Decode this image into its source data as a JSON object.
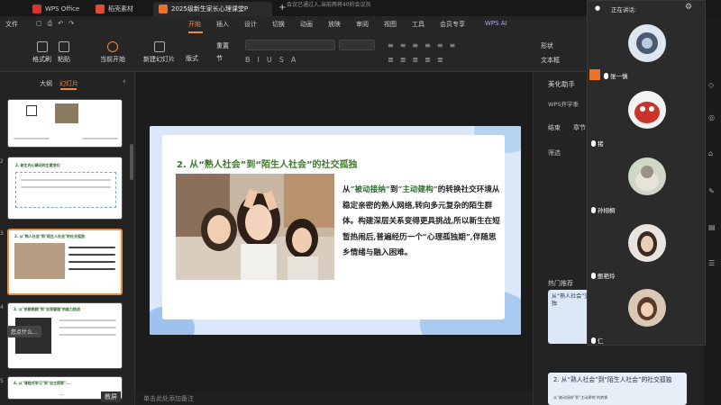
{
  "tabs": {
    "app": "WPS Office",
    "tab2": "稻壳素材",
    "tab3": "2025级新生家长心理课堂P",
    "notice": "会议已通过入,当前两将40的会议员"
  },
  "menu": {
    "file": "文件",
    "items": [
      "开始",
      "插入",
      "设计",
      "切换",
      "动画",
      "放映",
      "审阅",
      "视图",
      "工具",
      "会员专享"
    ],
    "ai": "WPS AI"
  },
  "ribbon": {
    "format_painter": "格式刷",
    "paste": "粘贴",
    "from_start": "当前开始",
    "new_slide": "新建幻灯片",
    "layout": "版式",
    "section": "节",
    "reset": "重置",
    "shape": "形状",
    "textbox": "文本框"
  },
  "left_panel": {
    "outline": "大纲",
    "slides": "幻灯片",
    "thumb2_title": "2. 新生内心躁动的主要变化",
    "thumb3_title": "2. 从\"熟人社会\"到\"陌生人社会\"的社交孤独",
    "thumb4_title": "3. 从\"依赖照顾\"到\"自我管理\"的能力挑战",
    "thumb5_title": "4. 从\"课程式学习\"到\"自主探索\"...",
    "search_overlay": "您点什么...",
    "add_icon": "+",
    "template_button": "教屏",
    "slide_numbers": [
      "1",
      "2",
      "3",
      "4",
      "5"
    ]
  },
  "slide": {
    "title": "2. 从“熟人社会”到“陌生人社会”的社交孤独",
    "body_prefix": "从",
    "body_hl1": "“被动接纳”",
    "body_mid": "到",
    "body_hl2": "“主动建构”",
    "body_rest": "的转换社交环境从稳定亲密的熟人网络,转向多元复杂的陌生群体。构建深层关系变得更具挑战,所以新生在短暂热闹后,普遍经历一个“心理孤独期”,伴随思乡情绪与融入困难。"
  },
  "notes_placeholder": "单击此处添加备注",
  "right_panel": {
    "beautify": "美化助手",
    "wps_school": "WPS开学季",
    "end": "结束",
    "chapter": "章节",
    "filter": "筛选",
    "hot": "热门推荐",
    "rec1": "2. 从“熟人社会”到“陌生人社会”的社交孤独",
    "rec1_short": "从“熟人社会”交孤独",
    "rec2_sub": "从“被动接纳”到“主动建构”的转换"
  },
  "call": {
    "speaking": "正在讲话:",
    "participants": [
      {
        "name": "张一慎"
      },
      {
        "name": "猪"
      },
      {
        "name": "孙栩桐"
      },
      {
        "name": "鲍艳玲"
      },
      {
        "name": "仁"
      }
    ]
  },
  "colors": {
    "accent": "#f08a3c",
    "title_green": "#3c7a2a",
    "slide_bg": "#dbe8fa"
  }
}
